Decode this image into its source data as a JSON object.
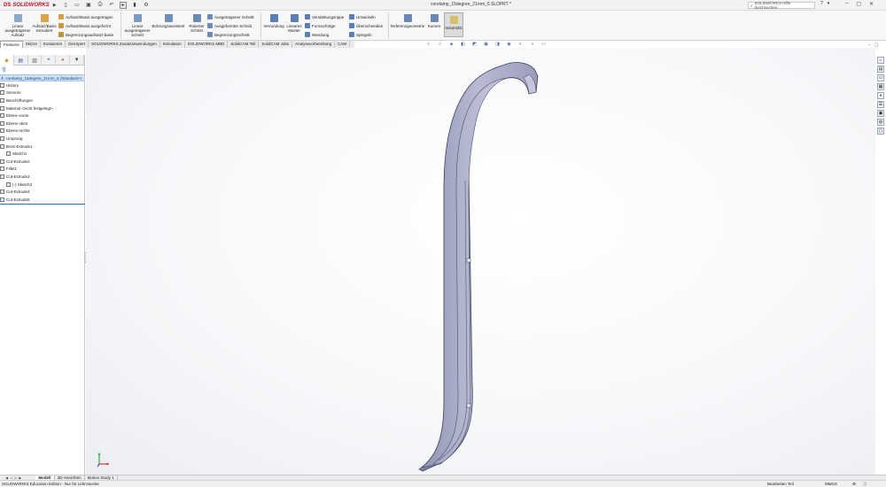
{
  "app": {
    "logo_ds": "DS",
    "logo_name": "SOLIDWORKS",
    "document_title": "corelamp_15degree_21mm_6.SLDPRT *",
    "search_placeholder": "SOLIDWORKS Hilfe durchsuchen",
    "brand_color": "#c8102e"
  },
  "quick_toolbar": {
    "icons": [
      "new-document-icon",
      "open-folder-icon",
      "save-icon",
      "print-icon",
      "undo-icon",
      "select-pointer-icon",
      "rebuild-icon",
      "options-gear-icon"
    ]
  },
  "command_manager": {
    "linear_pattern_boss": "Linear ausgetragener Aufsatz",
    "extruded_boss": "Aufsatz/Basis extrudiert",
    "swept_boss": "Aufsatz/Basis ausgetragen",
    "lofted_boss": "Aufsatz/Basis ausgeformt",
    "boundary_boss": "Begrenzungsaufsatz/-basis",
    "linear_cut": "Linear ausgetragener Schnitt",
    "hole_wizard": "Bohrungsassistent",
    "revolved_cut": "Rotierter Schnitt",
    "swept_cut": "Ausgetragener Schnitt",
    "lofted_cut": "Ausgeformter Schnitt",
    "boundary_cut": "Begrenzungsschnitt",
    "fillet": "Verrundung",
    "linear_pattern": "Lineares Muster",
    "rib": "Verstärkungsrippe",
    "draft": "Formschräge",
    "shell": "Wandung",
    "wrap": "Umwickeln",
    "intersect": "Überschneiden",
    "mirror": "Spiegeln",
    "reference_geometry": "Referenzgeometrie",
    "curves": "Kurven",
    "instant3d": "Instant3D"
  },
  "tabs": {
    "items": [
      "Features",
      "Skizze",
      "Evaluieren",
      "DimXpert",
      "SOLIDWORKS Zusatzanwendungen",
      "Simulation",
      "SOLIDWORKS MBD",
      "SolidCAM Teil",
      "SolidCAM Jobs",
      "Analysevorbereitung",
      "CAM"
    ],
    "active": "Features"
  },
  "feature_tree": {
    "root": "corelamp_15degree_21mm_6 (Standard<<",
    "items": [
      {
        "label": "History",
        "child": false
      },
      {
        "label": "Sensors",
        "child": false
      },
      {
        "label": "Beschriftungen",
        "child": false
      },
      {
        "label": "Material <nicht festgelegt>",
        "child": false
      },
      {
        "label": "Ebene vorne",
        "child": false
      },
      {
        "label": "Ebene oben",
        "child": false
      },
      {
        "label": "Ebene rechts",
        "child": false
      },
      {
        "label": "Ursprung",
        "child": false
      },
      {
        "label": "Boss-Extrude1",
        "child": false
      },
      {
        "label": "Sketch1",
        "child": true
      },
      {
        "label": "Cut-Extrude2",
        "child": false
      },
      {
        "label": "Fillet1",
        "child": false
      },
      {
        "label": "Cut-Extrude3",
        "child": false
      },
      {
        "label": "(-) Sketch3",
        "child": true
      },
      {
        "label": "Cut-Extrude4",
        "child": false
      },
      {
        "label": "Cut-Extrude5",
        "child": false
      }
    ]
  },
  "bottom_tabs": {
    "items": [
      "Modell",
      "3D-Ansichten",
      "Motion Study 1"
    ],
    "active": "Modell"
  },
  "status_bar": {
    "left": "SOLIDWORKS Education Edition - Nur für Lehrzwecke",
    "editing": "Bearbeiten Teil",
    "units": "MMGS"
  },
  "colors": {
    "model_fill": "#a9abc6",
    "model_edge": "#3a3c58",
    "selection_blue": "#cfe3f7"
  }
}
